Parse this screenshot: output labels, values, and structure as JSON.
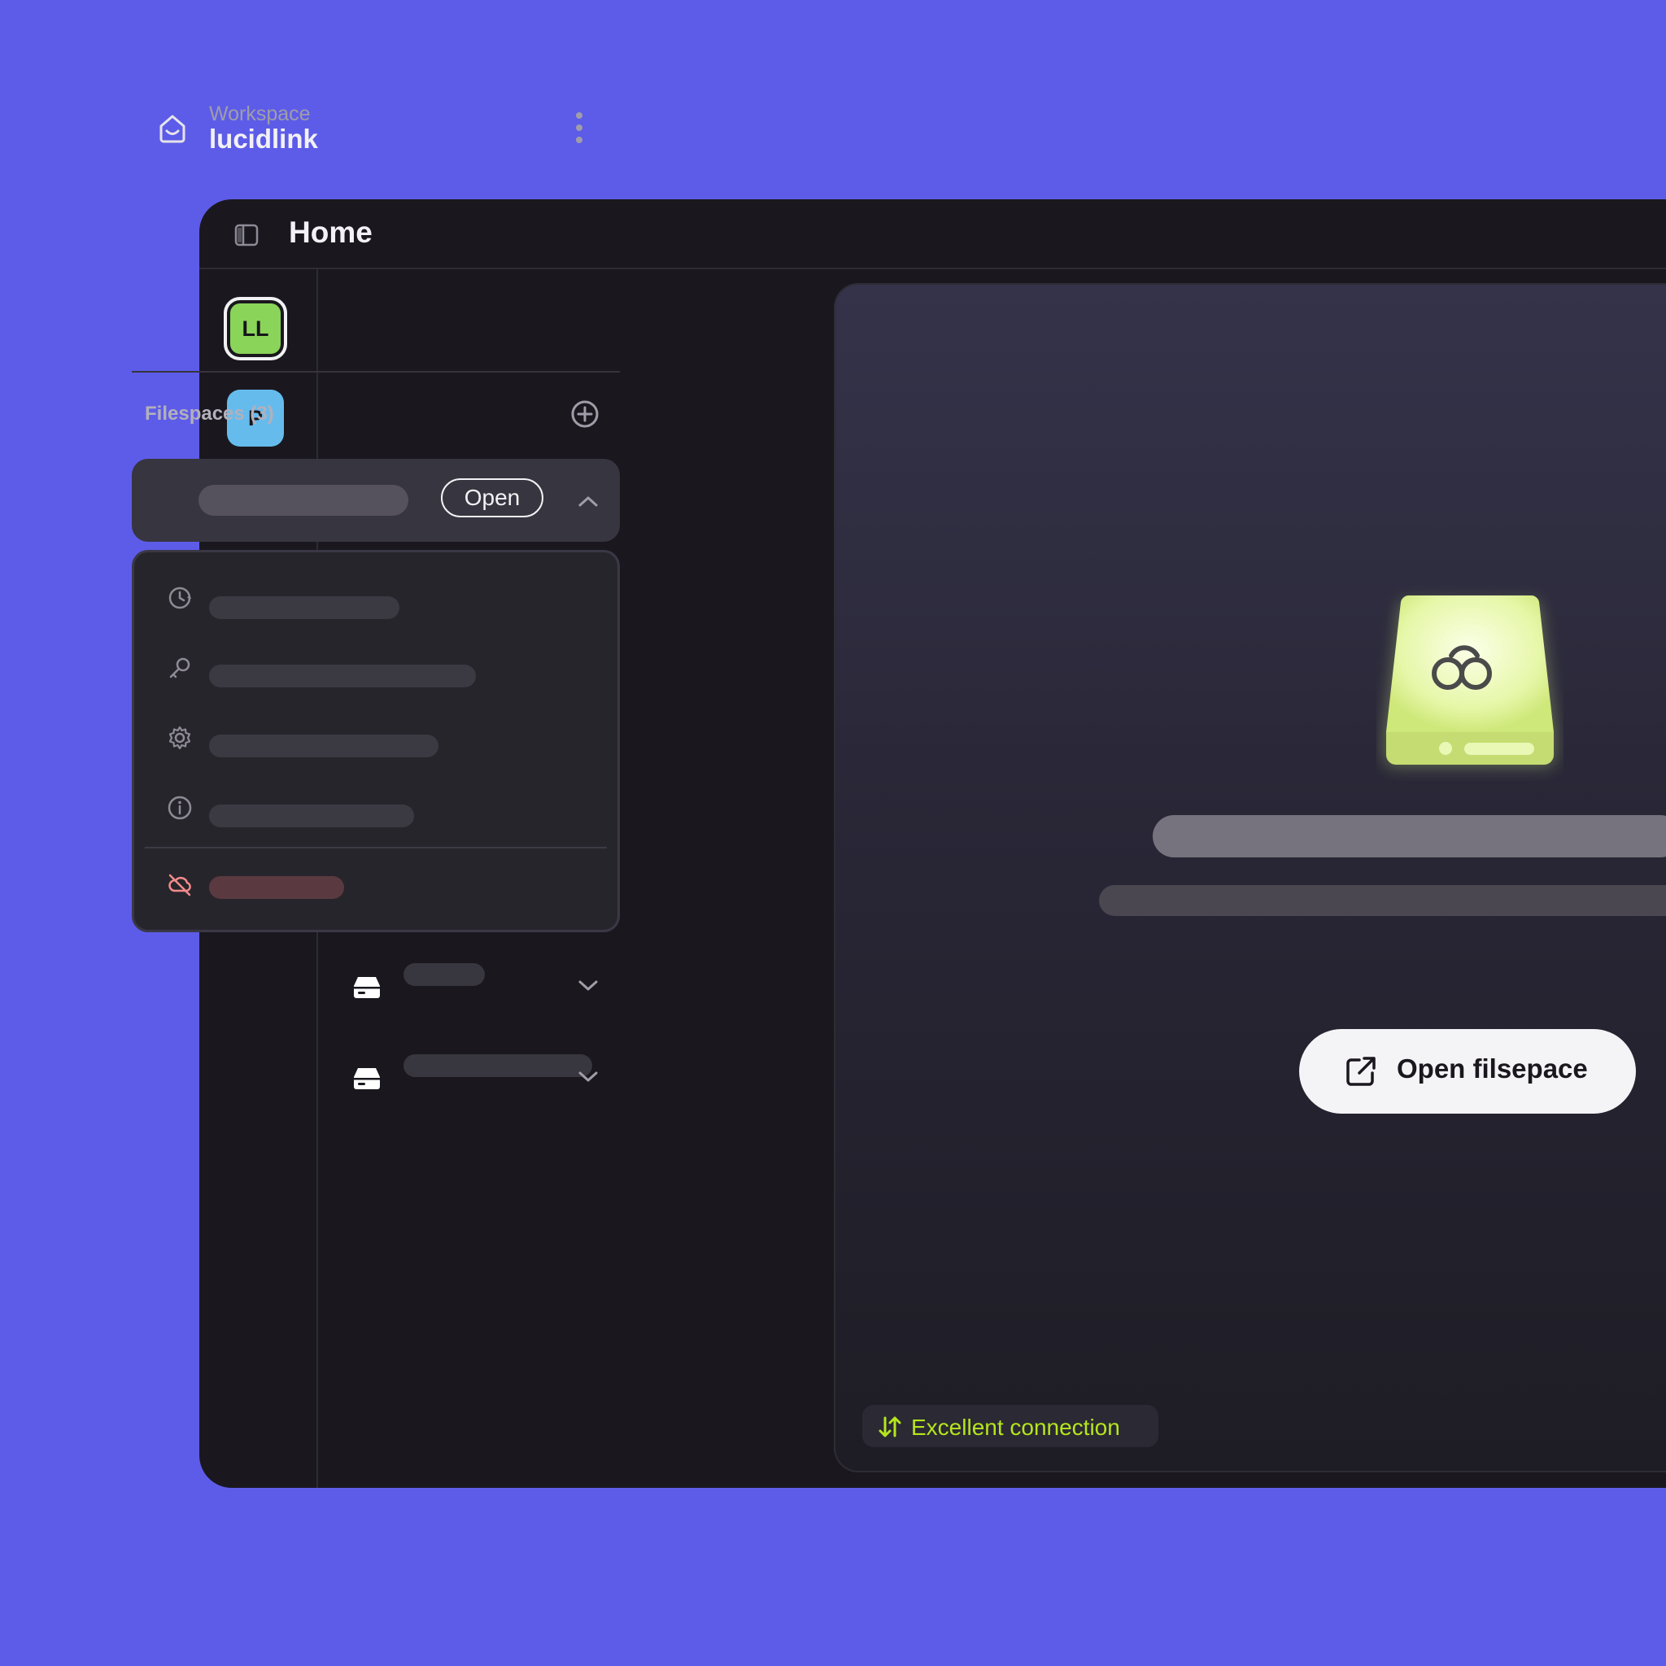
{
  "window": {
    "title": "Home"
  },
  "rail": {
    "workspaces": [
      {
        "initials": "LL",
        "color": "#8ad45a",
        "active": true
      },
      {
        "initials": "P",
        "color": "#66bbed",
        "active": false
      }
    ]
  },
  "workspace": {
    "label": "Workspace",
    "name": "lucidlink"
  },
  "filespaces": {
    "title": "Filespaces (3)",
    "open_label": "Open"
  },
  "main": {
    "open_button_label": "Open filsepace",
    "connection_status": "Excellent connection"
  },
  "colors": {
    "background": "#5d5ce8",
    "accent_green": "#b5e61d",
    "danger": "#f28b8b"
  }
}
